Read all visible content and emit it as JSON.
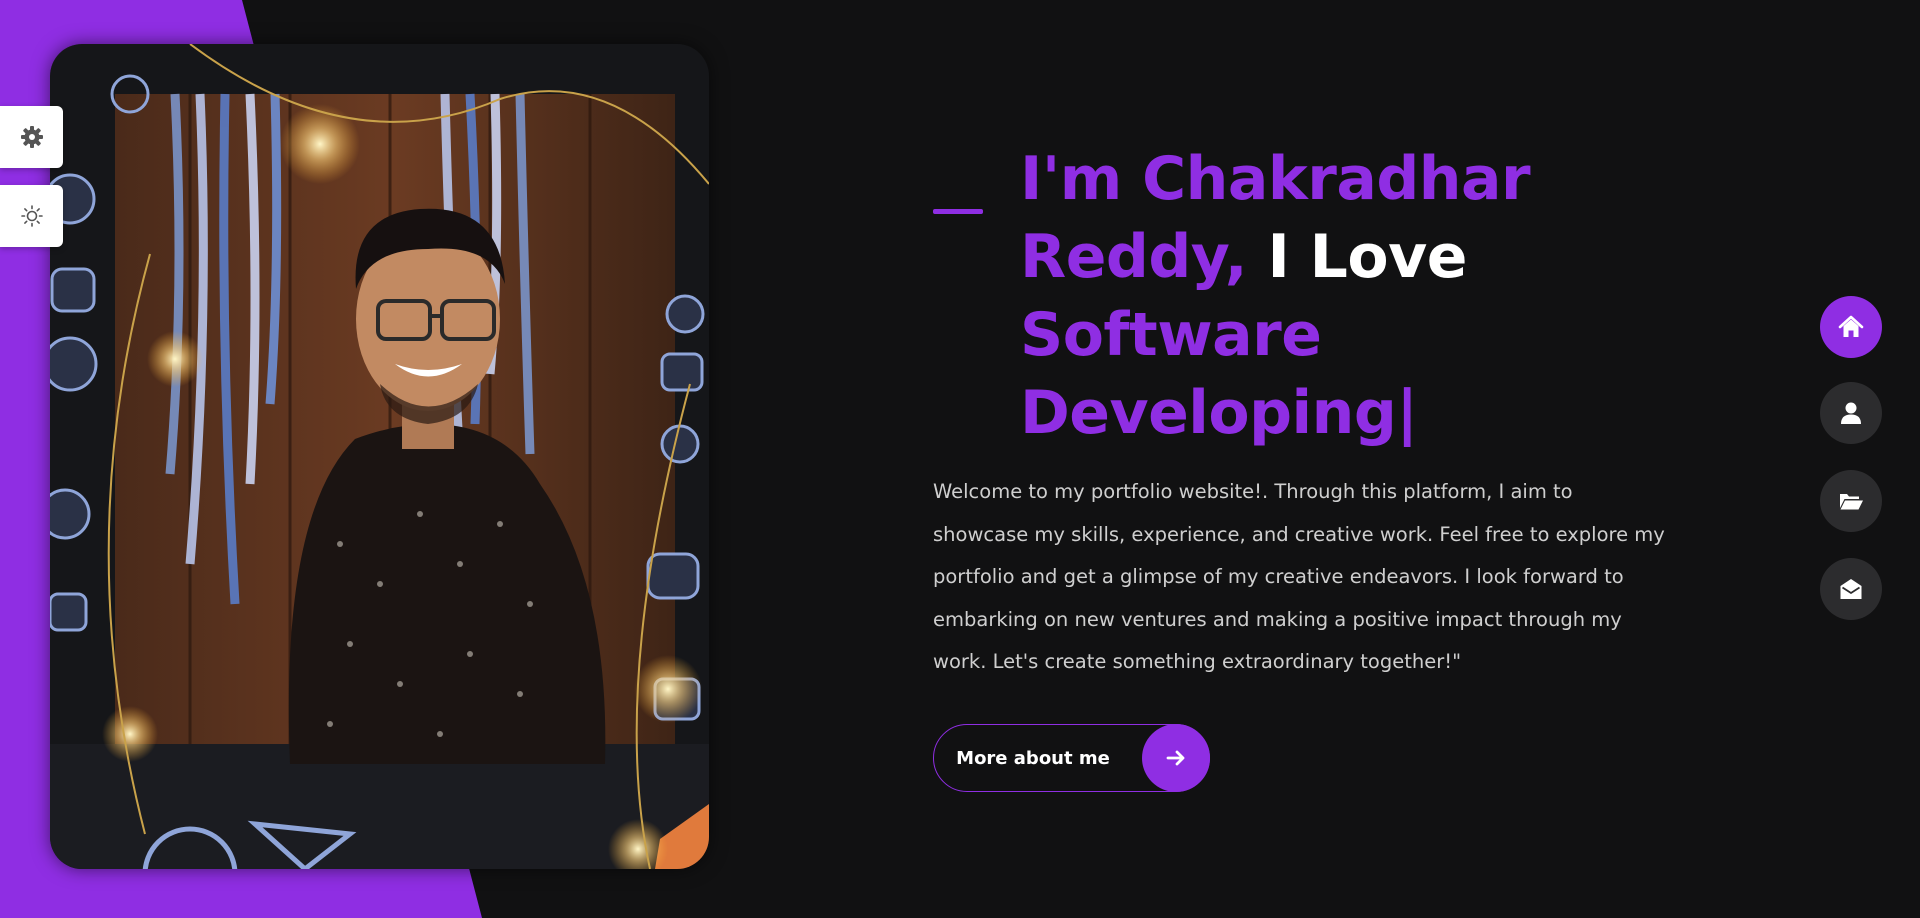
{
  "theme": {
    "accent": "#8f2ee3",
    "background": "#111112",
    "text_muted": "#cfcfcf",
    "nav_inactive": "#2c2c2e"
  },
  "sidebar_tools": [
    {
      "icon": "gear-icon"
    },
    {
      "icon": "sun-icon"
    }
  ],
  "hero": {
    "headline_part1": "I'm Chakradhar Reddy,",
    "headline_part2": "I Love",
    "headline_part3": "Software Developing|",
    "intro": "Welcome to my portfolio website!. Through this platform, I aim to showcase my skills, experience, and creative work. Feel free to explore my portfolio and get a glimpse of my creative endeavors. I look forward to embarking on new ventures and making a positive impact through my work. Let's create something extraordinary together!\"",
    "button_label": "More about me",
    "button_icon": "arrow-right-icon"
  },
  "right_nav": [
    {
      "icon": "home-icon",
      "active": true
    },
    {
      "icon": "user-icon",
      "active": false
    },
    {
      "icon": "folder-open-icon",
      "active": false
    },
    {
      "icon": "envelope-open-icon",
      "active": false
    }
  ]
}
